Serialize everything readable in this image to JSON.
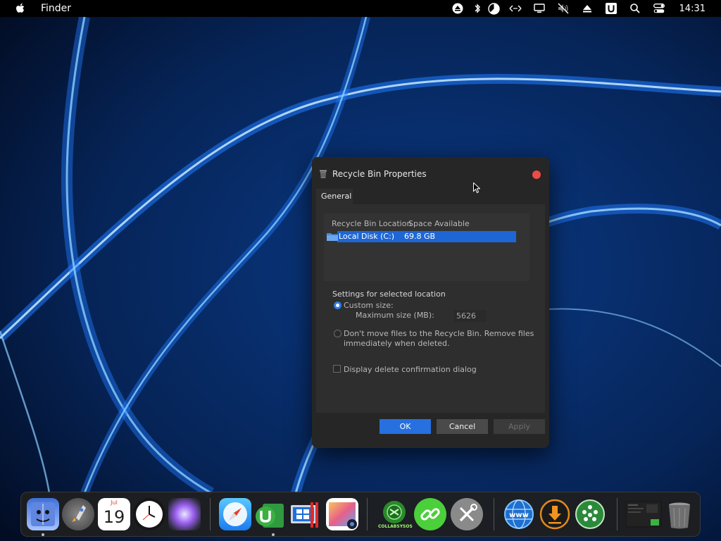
{
  "menubar": {
    "app_name": "Finder",
    "clock": "14:31",
    "icons": [
      "apple-icon",
      "eject-icon",
      "bluetooth-icon",
      "pie-chart-icon",
      "network-arrows-icon",
      "display-icon",
      "mute-icon",
      "eject-upload-icon",
      "u-badge-icon",
      "search-icon",
      "control-center-icon"
    ]
  },
  "dialog": {
    "title": "Recycle Bin Properties",
    "tab_general": "General",
    "columns": {
      "location": "Recycle Bin Location",
      "space": "Space Available"
    },
    "rows": [
      {
        "location": "Local Disk (C:)",
        "space": "69.8 GB"
      }
    ],
    "settings_title": "Settings for selected location",
    "custom_size_label": "Custom size:",
    "max_size_label": "Maximum size (MB):",
    "max_size_value": "5626",
    "dont_move_label_line1": "Don't move files to the Recycle Bin. Remove files",
    "dont_move_label_line2": "immediately when deleted.",
    "confirm_label": "Display delete confirmation dialog",
    "ok": "OK",
    "cancel": "Cancel",
    "apply": "Apply"
  },
  "dock": {
    "items": [
      "finder-icon",
      "launchpad-icon",
      "calendar-icon",
      "clock-icon",
      "siri-icon",
      "safari-icon",
      "utorrent-icon",
      "windows-app-icon",
      "photos-icon",
      "collabsysos-icon",
      "link-icon",
      "tools-icon",
      "www-icon",
      "download-icon",
      "network-icon",
      "screen-icon",
      "trash-icon"
    ],
    "calendar_month": "Jul",
    "calendar_day": "19",
    "collab_label": "COLLABSYSOS"
  },
  "colors": {
    "accent": "#2670e0",
    "close": "#ee4b47",
    "selection": "#1e66d4"
  }
}
